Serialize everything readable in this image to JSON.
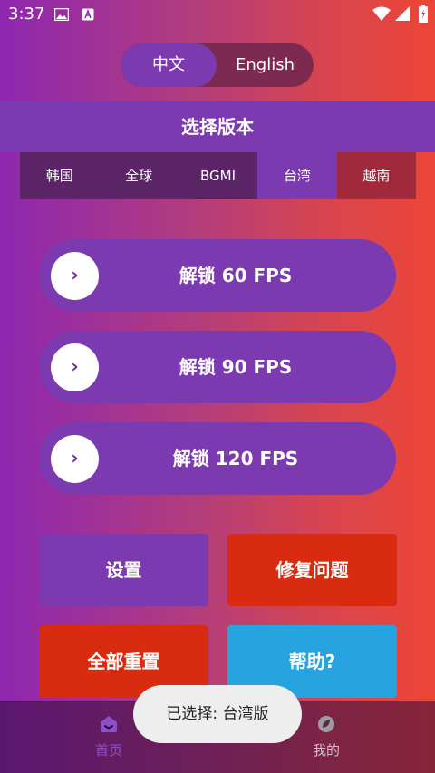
{
  "status_bar": {
    "time": "3:37"
  },
  "language": {
    "chinese": "中文",
    "english": "English",
    "selected": "中文"
  },
  "header": {
    "title": "选择版本"
  },
  "version_tabs": [
    {
      "label": "韩国"
    },
    {
      "label": "全球"
    },
    {
      "label": "BGMI"
    },
    {
      "label": "台湾",
      "selected": true
    },
    {
      "label": "越南"
    }
  ],
  "fps_buttons": [
    {
      "label": "解锁 60 FPS"
    },
    {
      "label": "解锁 90 FPS"
    },
    {
      "label": "解锁 120 FPS"
    }
  ],
  "actions": {
    "settings": "设置",
    "fix_issues": "修复问题",
    "reset_all": "全部重置",
    "help": "帮助?"
  },
  "bottom_nav": {
    "home": "首页",
    "mine": "我的"
  },
  "toast": {
    "message": "已选择: 台湾版"
  },
  "colors": {
    "purple": "#7b3ab0",
    "red": "#d92b10",
    "blue": "#27a4e0",
    "home_active": "#8e4fc9"
  }
}
